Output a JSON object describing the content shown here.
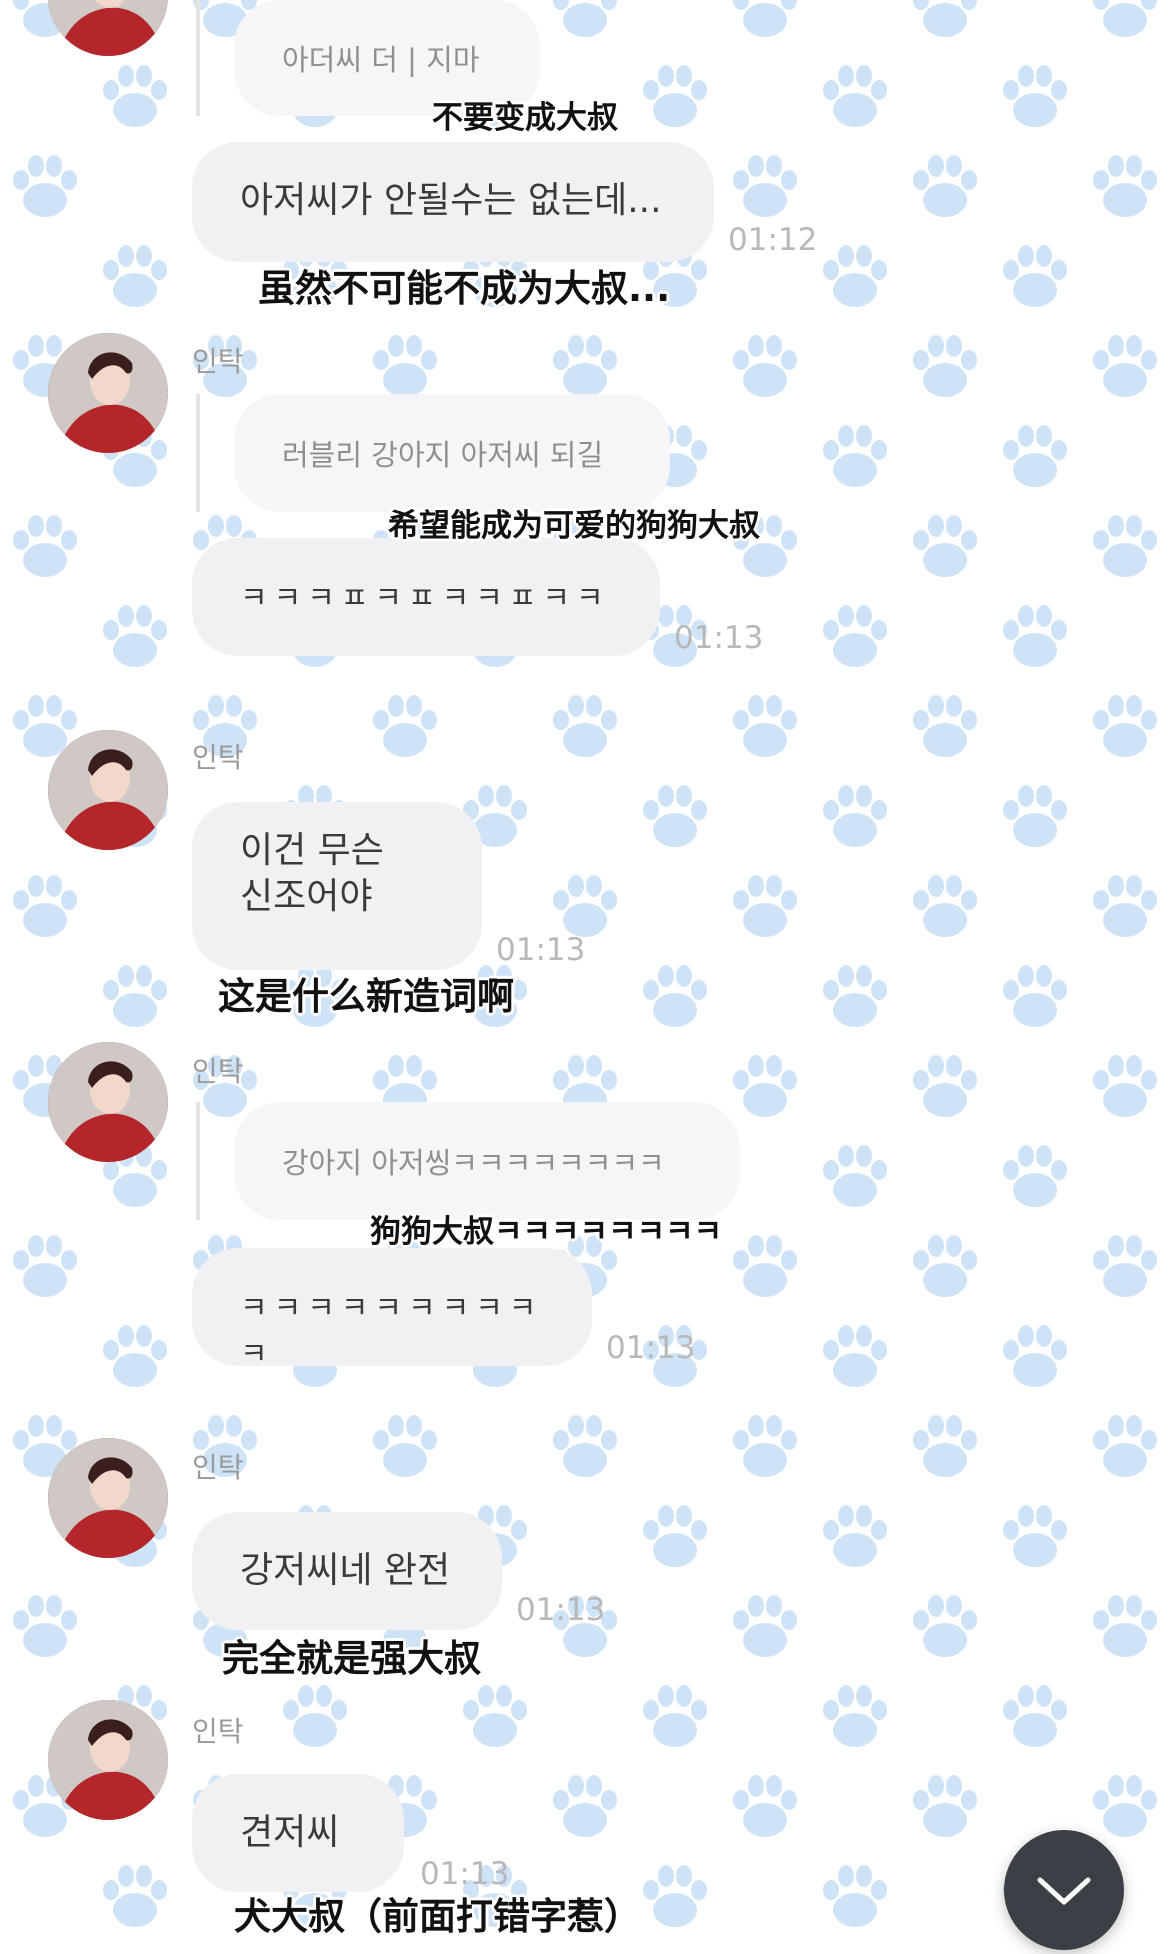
{
  "sender_name": "인탁",
  "scroll_button_icon": "chevron-down-icon",
  "wallpaper_icon": "paw-icon",
  "colors": {
    "bubble": "#f1f1f3",
    "paw": "#cfe3f6",
    "scroll_button": "#3a4046"
  },
  "messages": [
    {
      "quote": "아더씨 더 | 지마",
      "quote_sub": "不要变成大叔",
      "text": "아저씨가 안될수는 없는데...",
      "time": "01:12",
      "sub": "虽然不可能不成为大叔..."
    },
    {
      "sender": "인탁",
      "quote": "러블리 강아지 아저씨 되길",
      "quote_sub": "希望能成为可爱的狗狗大叔",
      "text": "ㅋㅋㅋㅍㅋㅍㅋㅋㅍㅋㅋ",
      "time": "01:13"
    },
    {
      "sender": "인탁",
      "text_line1": "이건 무슨",
      "text_line2": "신조어야",
      "time": "01:13",
      "sub": "这是什么新造词啊"
    },
    {
      "sender": "인탁",
      "quote": "강아지 아저씽ㅋㅋㅋㅋㅋㅋㅋㅋ",
      "quote_sub": "狗狗大叔ㅋㅋㅋㅋㅋㅋㅋㅋ",
      "text": "ㅋㅋㅋㅋㅋㅋㅋㅋㅋㅋ",
      "time": "01:13"
    },
    {
      "sender": "인탁",
      "text": "강저씨네 완전",
      "time": "01:13",
      "sub": "完全就是强大叔"
    },
    {
      "sender": "인탁",
      "text": "견저씨",
      "time": "01:13",
      "sub": "犬大叔（前面打错字惹）"
    }
  ]
}
